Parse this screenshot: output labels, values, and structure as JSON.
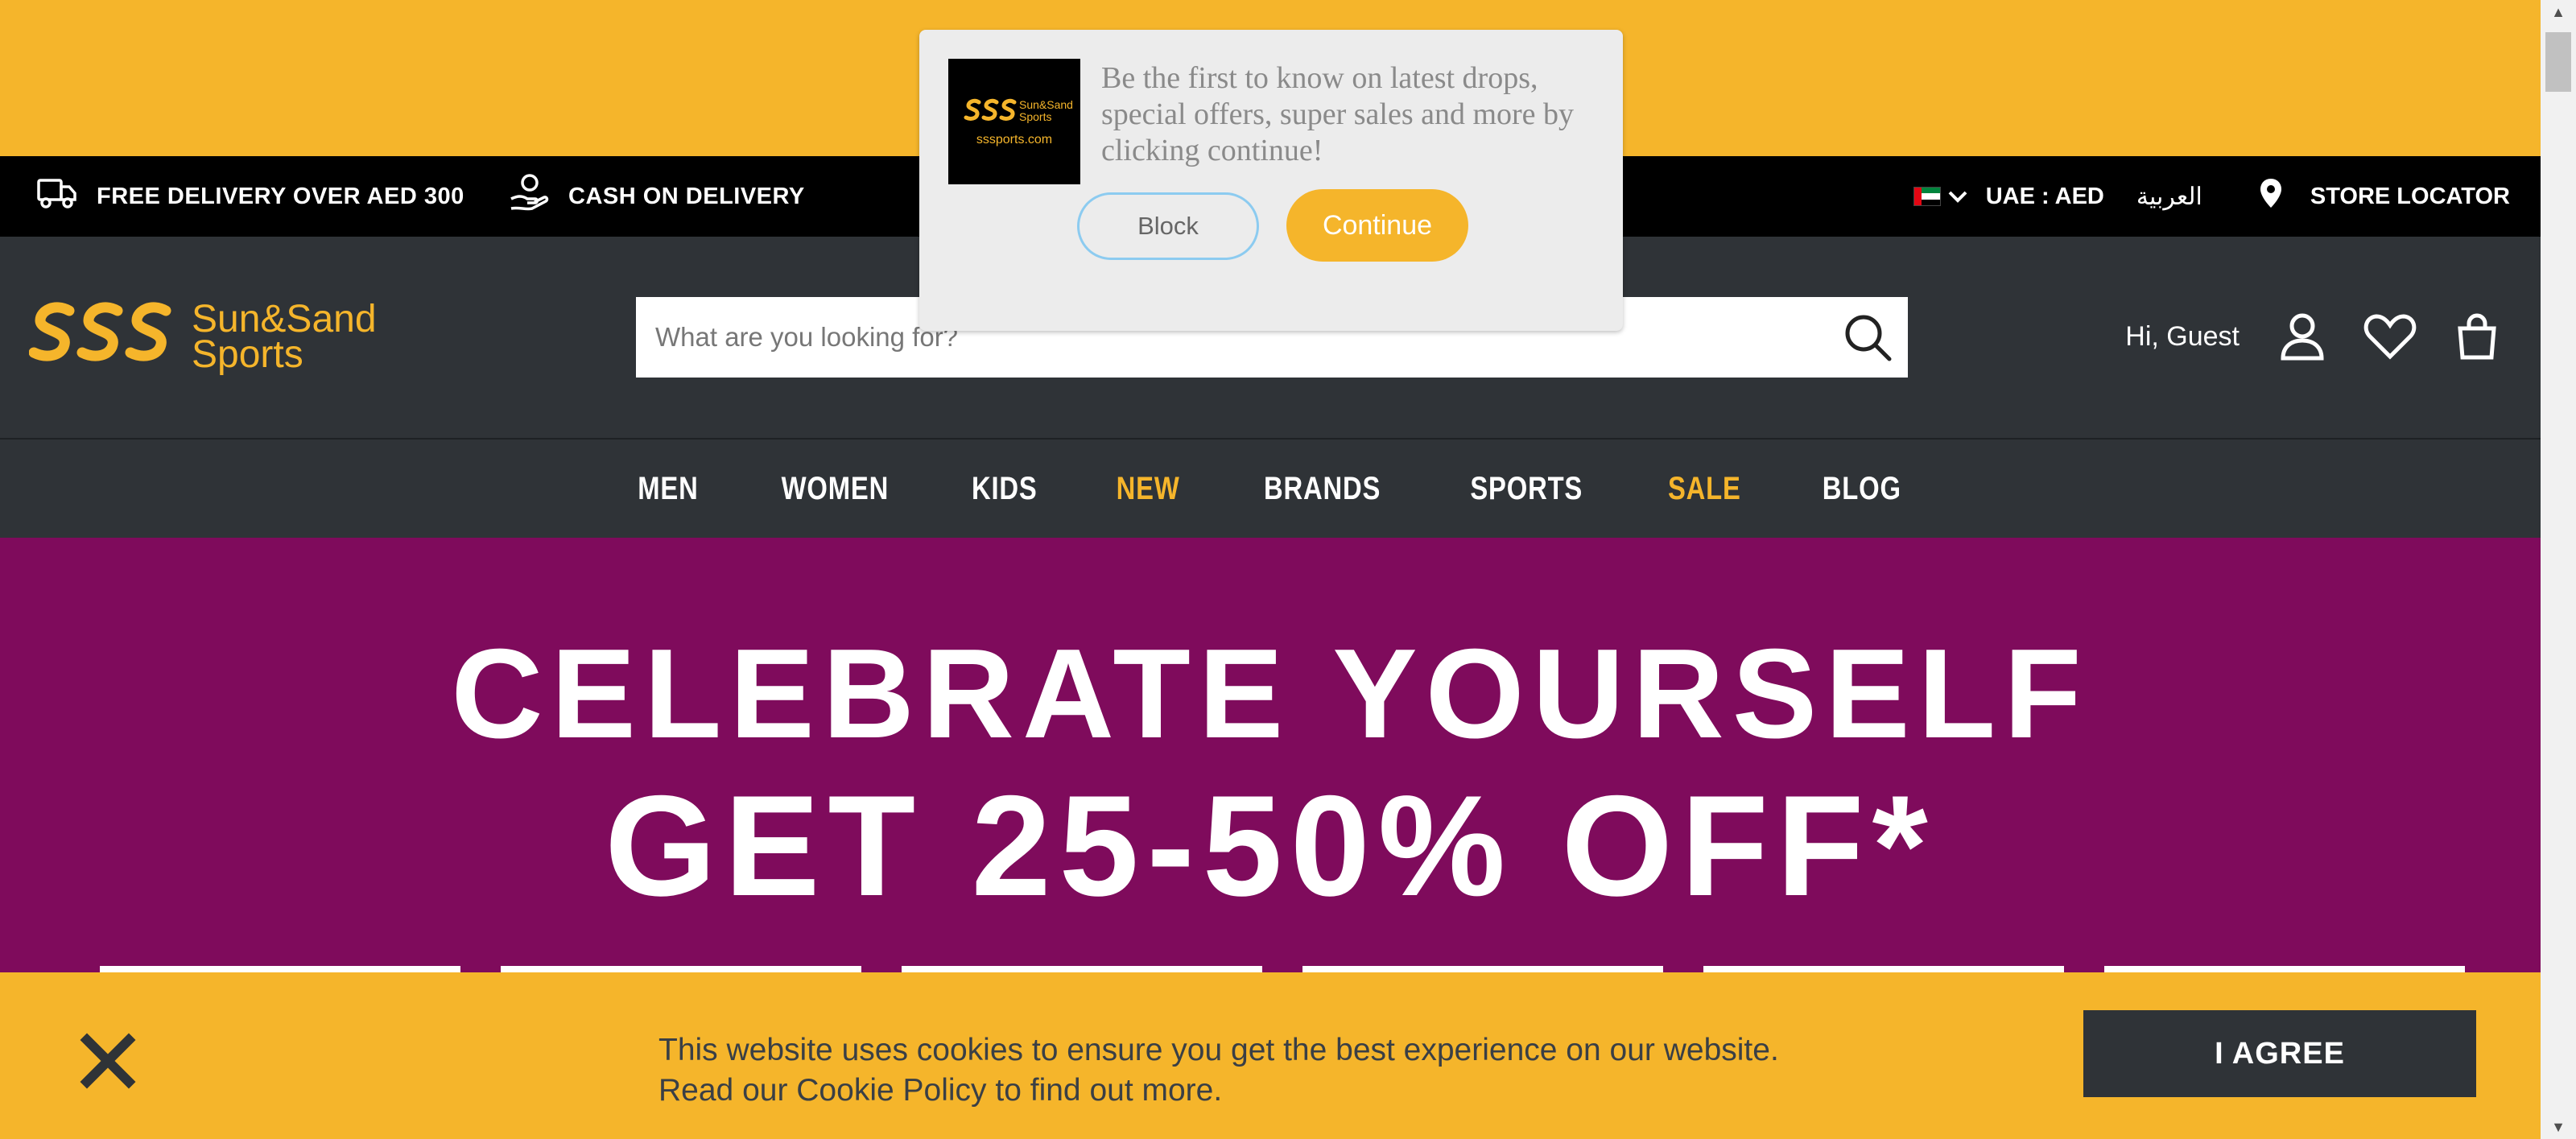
{
  "colors": {
    "brand_yellow": "#f5b52b",
    "header_dark": "#2f3337",
    "hero_purple": "#7f0b5c",
    "info_bar": "#000000"
  },
  "info_bar": {
    "delivery_icon": "truck-icon",
    "delivery_text": "FREE DELIVERY OVER AED 300",
    "cod_icon": "cash-hand-icon",
    "cod_text": "CASH ON DELIVERY",
    "region_flag": "uae-flag-icon",
    "region_text": "UAE : AED",
    "language_link": "العربية",
    "store_icon": "map-pin-icon",
    "store_locator": "STORE LOCATOR"
  },
  "header": {
    "logo_line1": "Sun&Sand",
    "logo_line2": "Sports",
    "search_placeholder": "What are you looking for?",
    "greeting": "Hi, Guest",
    "icons": [
      "user-icon",
      "heart-icon",
      "bag-icon"
    ]
  },
  "nav": {
    "items": [
      {
        "label": "MEN"
      },
      {
        "label": "WOMEN"
      },
      {
        "label": "KIDS"
      },
      {
        "label": "NEW"
      },
      {
        "label": "BRANDS"
      },
      {
        "label": "SPORTS"
      },
      {
        "label": "SALE"
      },
      {
        "label": "BLOG"
      }
    ]
  },
  "hero": {
    "line1": "CELEBRATE YOURSELF",
    "line2": "GET 25-50% OFF*"
  },
  "cookie": {
    "line1": "This website uses cookies to ensure you get the best experience on our website.",
    "line2": "Read our Cookie Policy to find out more.",
    "agree_label": "I AGREE"
  },
  "prompt": {
    "logo_line1": "Sun&Sand",
    "logo_line2": "Sports",
    "logo_site": "sssports.com",
    "message": "Be the first to know on latest drops, special offers, super sales and more by clicking continue!",
    "block_label": "Block",
    "continue_label": "Continue"
  }
}
